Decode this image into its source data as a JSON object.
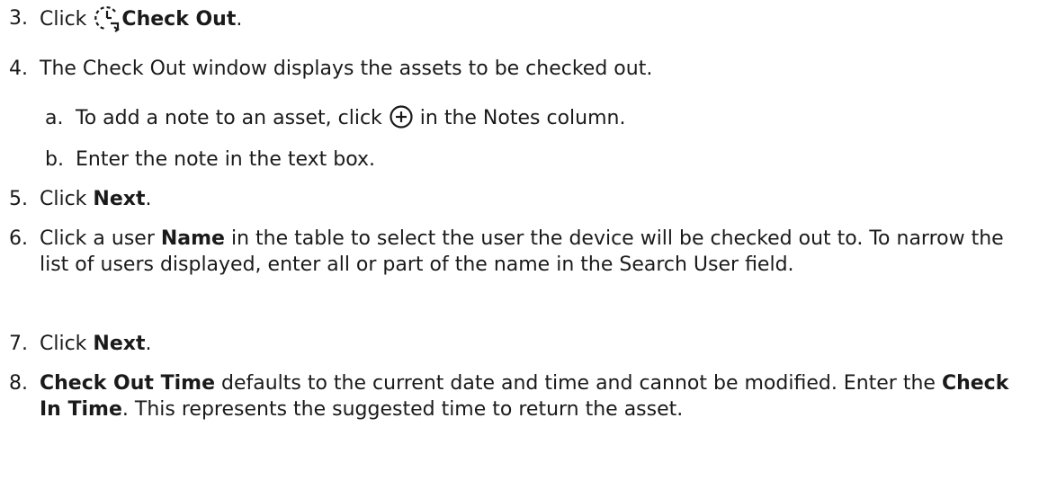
{
  "steps": [
    {
      "num": "3.",
      "pre": "Click ",
      "bold": "Check Out",
      "post": ".",
      "icon": "clock-arrow-icon"
    },
    {
      "num": "4.",
      "text": "The Check Out window displays the assets to be checked out."
    },
    {
      "num": "5.",
      "pre": "Click ",
      "bold": "Next",
      "post": "."
    },
    {
      "num": "6.",
      "pre": "Click a user ",
      "bold": "Name",
      "post": " in the table to select the user the device will be checked out to. To narrow the list of users displayed, enter all or part of the name in the Search User field."
    },
    {
      "num": "7.",
      "pre": "Click ",
      "bold": "Next",
      "post": "."
    },
    {
      "num": "8.",
      "bold1": "Check Out Time",
      "mid": " defaults to the current date and time and cannot be modified. Enter the ",
      "bold2": "Check In Time",
      "post": ". This represents the suggested time to return the asset."
    }
  ],
  "substeps": [
    {
      "num": "a.",
      "pre": "To add a note to an asset, click ",
      "post": " in the Notes column.",
      "icon": "plus-circle-icon"
    },
    {
      "num": "b.",
      "text": "Enter the note in the text box."
    }
  ]
}
